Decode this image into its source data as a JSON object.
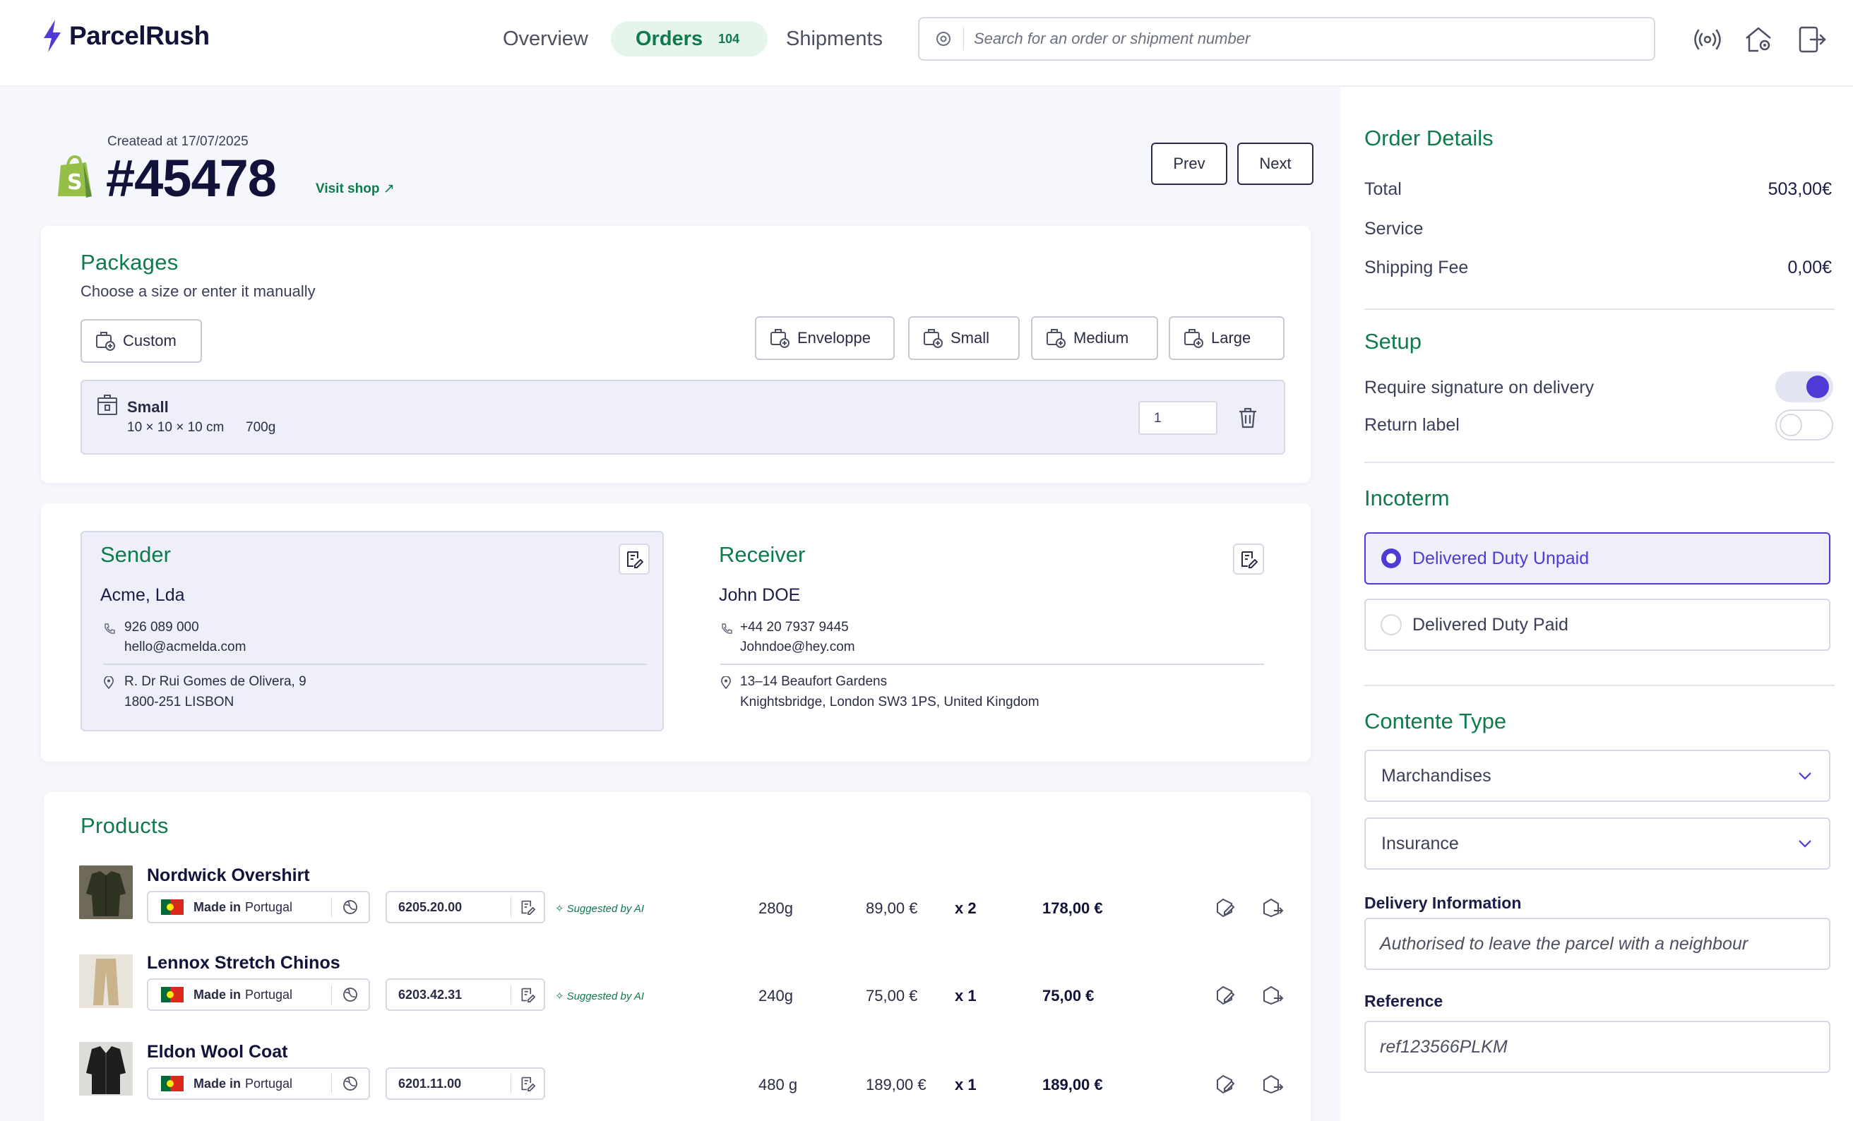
{
  "app": {
    "name": "ParcelRush"
  },
  "nav": {
    "overview": "Overview",
    "orders": "Orders",
    "orders_count": "104",
    "shipments": "Shipments"
  },
  "search": {
    "placeholder": "Search for an order or shipment number"
  },
  "order": {
    "created": "Createad at 17/07/2025",
    "number": "#45478",
    "visit_shop": "Visit shop",
    "prev": "Prev",
    "next": "Next"
  },
  "packages": {
    "title": "Packages",
    "subtitle": "Choose a size or enter it manually",
    "custom_label": "Custom",
    "presets": [
      "Enveloppe",
      "Small",
      "Medium",
      "Large"
    ],
    "selected": {
      "name": "Small",
      "dims": "10 × 10 × 10 cm",
      "weight": "700g",
      "quantity": "1"
    }
  },
  "sender": {
    "title": "Sender",
    "name": "Acme, Lda",
    "phone": "926 089 000",
    "email": "hello@acmelda.com",
    "address1": "R. Dr Rui Gomes de Olivera, 9",
    "address2": "1800-251 LISBON"
  },
  "receiver": {
    "title": "Receiver",
    "name": "John DOE",
    "phone": "+44 20 7937 9445",
    "email": "Johndoe@hey.com",
    "address1": "13–14 Beaufort Gardens",
    "address2": "Knightsbridge, London SW3 1PS, United Kingdom"
  },
  "products": {
    "title": "Products",
    "made_in_prefix": "Made in",
    "items": [
      {
        "name": "Nordwick Overshirt",
        "origin": "Portugal",
        "hs_code": "6205.20.00",
        "suggested": "Suggested by AI",
        "weight": "280g",
        "unit_price": "89,00 €",
        "qty": "x 2",
        "total": "178,00 €"
      },
      {
        "name": "Lennox Stretch Chinos",
        "origin": "Portugal",
        "hs_code": "6203.42.31",
        "suggested": "Suggested by AI",
        "weight": "240g",
        "unit_price": "75,00 €",
        "qty": "x 1",
        "total": "75,00 €"
      },
      {
        "name": "Eldon Wool Coat",
        "origin": "Portugal",
        "hs_code": "6201.11.00",
        "suggested": "",
        "weight": "480 g",
        "unit_price": "189,00 €",
        "qty": "x 1",
        "total": "189,00 €"
      }
    ]
  },
  "order_details": {
    "title": "Order Details",
    "total_label": "Total",
    "total_value": "503,00€",
    "service_label": "Service",
    "shipping_label": "Shipping Fee",
    "shipping_value": "0,00€"
  },
  "setup": {
    "title": "Setup",
    "signature_label": "Require signature on delivery",
    "signature_on": true,
    "return_label": "Return label",
    "return_on": false
  },
  "incoterm": {
    "title": "Incoterm",
    "options": [
      "Delivered Duty Unpaid",
      "Delivered Duty Paid"
    ],
    "selected": "Delivered Duty Unpaid"
  },
  "content_type": {
    "title": "Contente Type",
    "category": "Marchandises",
    "insurance": "Insurance"
  },
  "delivery_info": {
    "label": "Delivery Information",
    "value": "Authorised to leave the parcel with a neighbour"
  },
  "reference": {
    "label": "Reference",
    "value": "ref123566PLKM"
  },
  "colors": {
    "brand_green": "#0f7a4b",
    "accent_purple": "#4f3ad6",
    "navy": "#12133a"
  }
}
